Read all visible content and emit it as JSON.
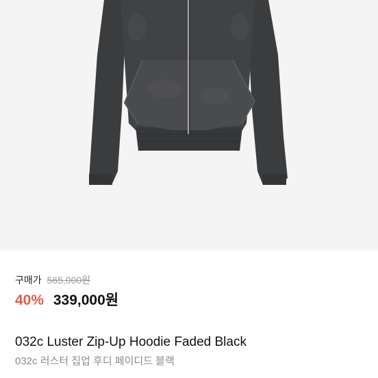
{
  "product": {
    "image_alt": "032c Luster Zip-Up Hoodie Faded Black",
    "purchase_label": "구매가",
    "original_price": "565,000원",
    "discount_percent": "40%",
    "sale_price": "339,000원",
    "title_en": "032c Luster Zip-Up Hoodie Faded Black",
    "title_ko": "032c 러스터 집업 후디 페이디드 블랙"
  },
  "colors": {
    "discount": "#e25a4a",
    "garment": "#3f4042",
    "background": "#f4f4f4"
  }
}
